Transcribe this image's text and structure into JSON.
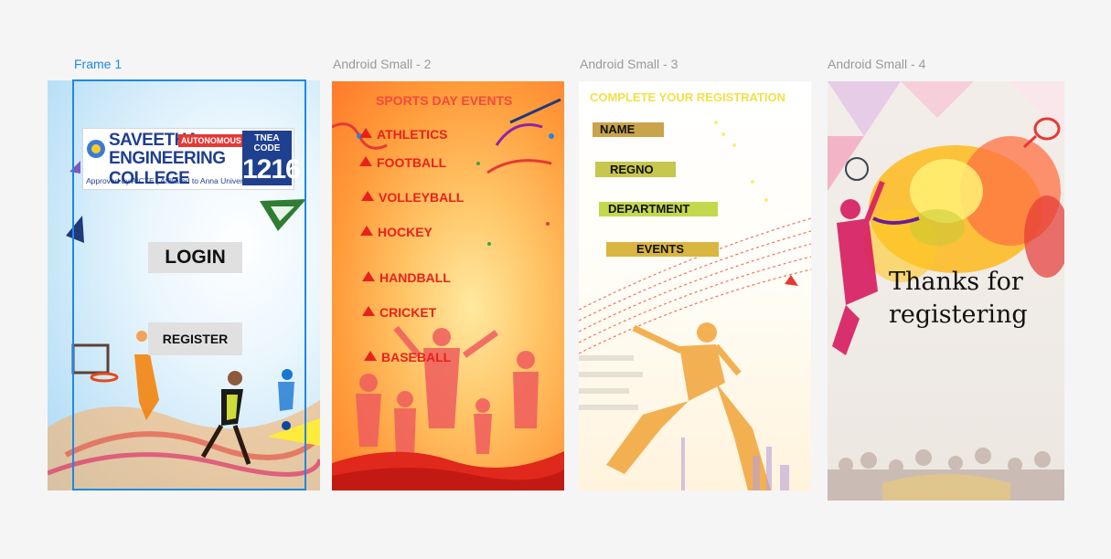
{
  "frames": [
    {
      "label": "Frame 1"
    },
    {
      "label": "Android Small - 2"
    },
    {
      "label": "Android Small - 3"
    },
    {
      "label": "Android Small - 4"
    }
  ],
  "logo": {
    "line1": "SAVEETHA",
    "autonomous": "AUTONOMOUS",
    "line2": "ENGINEERING COLLEGE",
    "subline": "Approved by AICTE | Affiliated to Anna University",
    "tnea_label": "TNEA CODE",
    "tnea_code": "1216"
  },
  "login_screen": {
    "login_label": "LOGIN",
    "register_label": "REGISTER"
  },
  "events_screen": {
    "title": "SPORTS DAY EVENTS",
    "events": [
      "ATHLETICS",
      "FOOTBALL",
      "VOLLEYBALL",
      "HOCKEY",
      "HANDBALL",
      "CRICKET",
      "BASEBALL"
    ]
  },
  "registration_screen": {
    "title": "COMPLETE YOUR REGISTRATION",
    "fields": [
      "NAME",
      "REGNO",
      "DEPARTMENT",
      "EVENTS"
    ],
    "colors": {
      "name": "#c9a44a",
      "regno": "#c7c64e",
      "department": "#c4d84e",
      "events": "#d9b640"
    }
  },
  "thanks_screen": {
    "line1": "Thanks for",
    "line2": "registering"
  },
  "colors": {
    "selection": "#1e88e5",
    "event_red": "#e8221b",
    "title_yellow": "#f4e04a"
  }
}
